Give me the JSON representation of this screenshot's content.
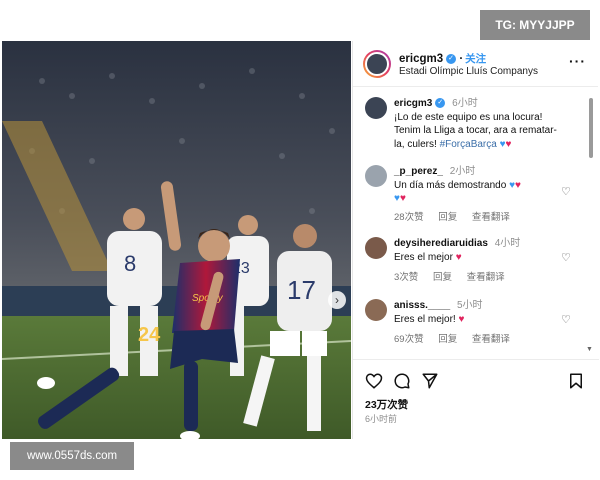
{
  "watermarks": {
    "top": "TG: MYYJJPP",
    "bottom": "www.0557ds.com"
  },
  "photo": {
    "jersey_numbers": [
      "8",
      "24",
      "23",
      "17"
    ],
    "sponsor": "Spotify"
  },
  "post_header": {
    "username": "ericgm3",
    "follow_label": "关注",
    "location": "Estadi Olímpic Lluís Companys",
    "more_icon": "more-horizontal-icon"
  },
  "caption": {
    "username": "ericgm3",
    "time": "6小时",
    "text_line1": "¡Lo de este equipo es una locura!",
    "text_line2": "Tenim la Lliga a tocar, ara a rematar-",
    "text_line3": "la, culers!",
    "hashtag": "#ForçaBarça"
  },
  "comments": [
    {
      "username": "_p_perez_",
      "time": "2小时",
      "text": "Un día más demostrando",
      "likes": "28次赞",
      "reply": "回复",
      "translate": "查看翻译"
    },
    {
      "username": "deysiherediaruidias",
      "time": "4小时",
      "text": "Eres el mejor",
      "likes": "3次赞",
      "reply": "回复",
      "translate": "查看翻译"
    },
    {
      "username": "anisss.____",
      "time": "5小时",
      "text": "Eres el mejor!",
      "likes": "69次赞",
      "reply": "回复",
      "translate": "查看翻译"
    }
  ],
  "actions": {
    "like_count": "23万次赞",
    "posted_ago": "6小时前"
  },
  "colors": {
    "blue": "#3897f0",
    "red": "#e0245e",
    "barca_blue": "#1c2f6b",
    "barca_red": "#b0183a"
  }
}
